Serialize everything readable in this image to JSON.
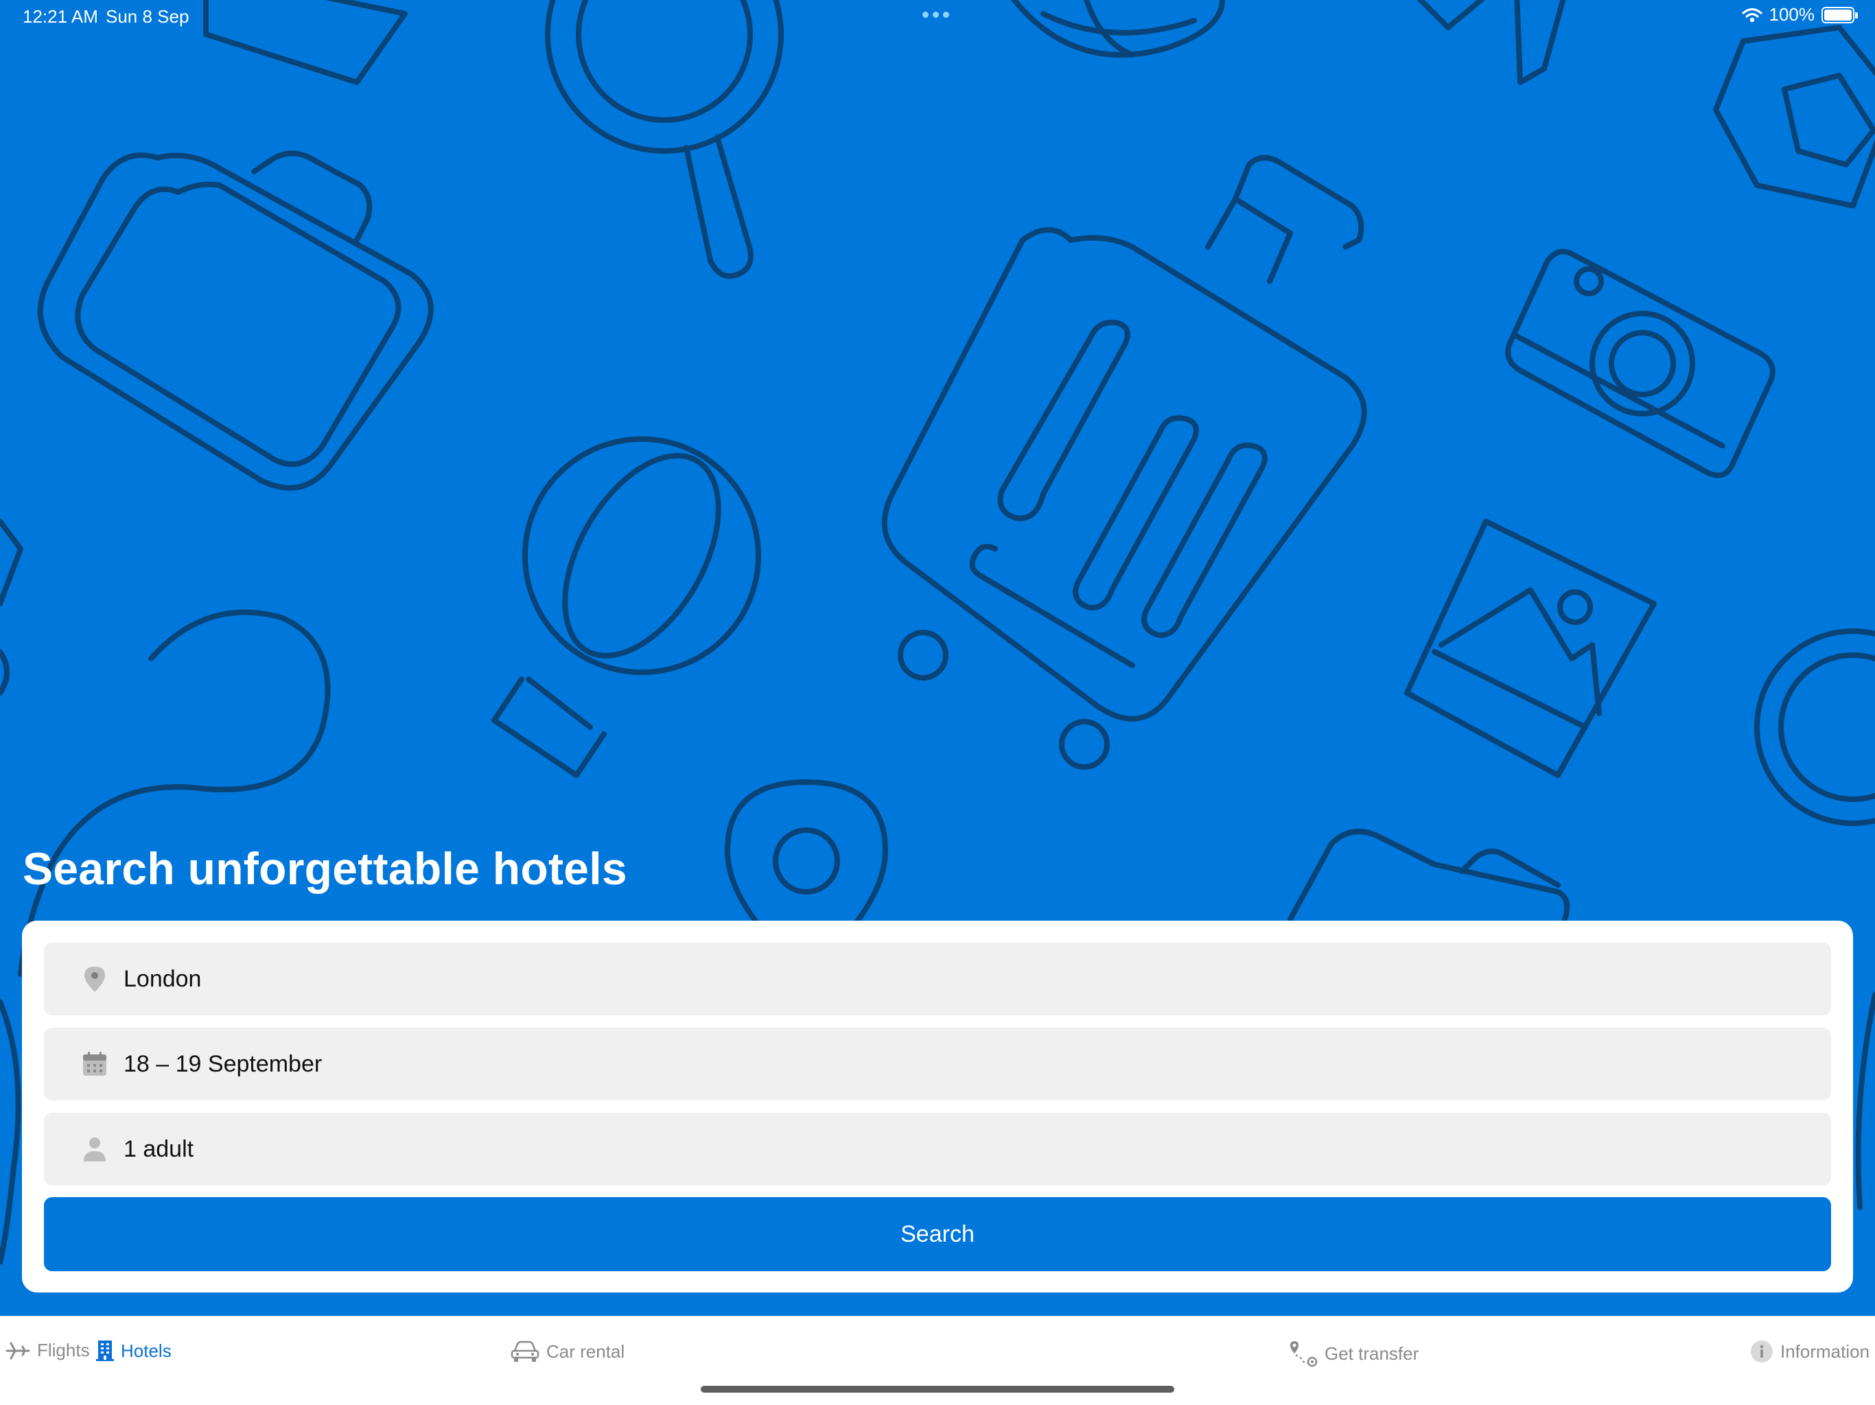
{
  "status_bar": {
    "time": "12:21 AM",
    "date": "Sun 8 Sep",
    "battery": "100%",
    "icons": [
      "wifi-icon",
      "battery-icon"
    ]
  },
  "hero": {
    "title": "Search unforgettable hotels",
    "background_color": "#0077db",
    "pattern_icons": [
      "suitcase",
      "magnifier",
      "globe",
      "airplane",
      "bag",
      "hot-air-balloon",
      "rolling-suitcase",
      "camera",
      "photo",
      "map-pin"
    ]
  },
  "search_form": {
    "destination": {
      "icon": "map-pin-icon",
      "value": "London"
    },
    "dates": {
      "icon": "calendar-icon",
      "value": "18 – 19 September"
    },
    "guests": {
      "icon": "person-icon",
      "value": "1 adult"
    },
    "search_label": "Search"
  },
  "tab_bar": {
    "items": [
      {
        "label": "Flights",
        "icon": "airplane-icon",
        "active": false
      },
      {
        "label": "Hotels",
        "icon": "building-icon",
        "active": true
      },
      {
        "label": "Car rental",
        "icon": "car-icon",
        "active": false
      },
      {
        "label": "Get transfer",
        "icon": "route-icon",
        "active": false
      },
      {
        "label": "Information",
        "icon": "info-icon",
        "active": false
      }
    ]
  },
  "colors": {
    "brand_blue": "#0077db",
    "active_tab": "#0a6fd6",
    "inactive_tab": "#8a8a8a",
    "field_bg": "#f0f0f0",
    "pattern_stroke": "#0b3b66"
  }
}
